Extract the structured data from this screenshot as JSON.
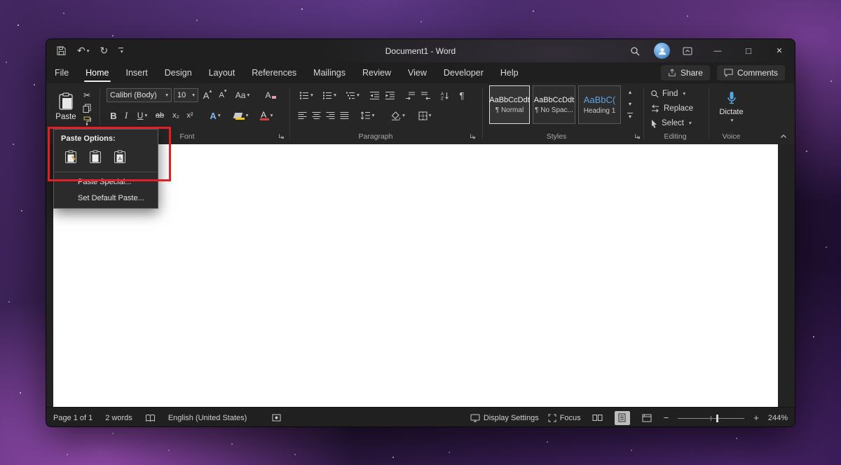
{
  "titlebar": {
    "title": "Document1  -  Word"
  },
  "tabs": {
    "items": [
      {
        "label": "File"
      },
      {
        "label": "Home"
      },
      {
        "label": "Insert"
      },
      {
        "label": "Design"
      },
      {
        "label": "Layout"
      },
      {
        "label": "References"
      },
      {
        "label": "Mailings"
      },
      {
        "label": "Review"
      },
      {
        "label": "View"
      },
      {
        "label": "Developer"
      },
      {
        "label": "Help"
      }
    ],
    "share": "Share",
    "comments": "Comments"
  },
  "ribbon": {
    "paste_label": "Paste",
    "font_name": "Calibri (Body)",
    "font_size": "10",
    "grow": "A",
    "shrink": "A",
    "change_case": "Aa",
    "clear": "A",
    "bold": "B",
    "italic": "I",
    "underline": "U",
    "strikethrough": "ab",
    "subscript": "x₂",
    "superscript": "x²",
    "effects": "A",
    "font_color": "A",
    "groups": {
      "font": "Font",
      "paragraph": "Paragraph",
      "styles": "Styles",
      "editing": "Editing",
      "voice": "Voice"
    },
    "styles": [
      {
        "preview": "AaBbCcDdt",
        "name": "¶ Normal"
      },
      {
        "preview": "AaBbCcDdt",
        "name": "¶ No Spac..."
      },
      {
        "preview": "AaBbC(",
        "name": "Heading 1"
      }
    ],
    "editing": {
      "find": "Find",
      "replace": "Replace",
      "select": "Select"
    },
    "voice": {
      "dictate": "Dictate"
    }
  },
  "paste_menu": {
    "title": "Paste Options:",
    "items": [
      {
        "label": "Paste Special..."
      },
      {
        "label": "Set Default Paste..."
      }
    ]
  },
  "status": {
    "page": "Page 1 of 1",
    "words": "2 words",
    "language": "English (United States)",
    "display_settings": "Display Settings",
    "focus": "Focus",
    "zoom_out": "−",
    "zoom_in": "+",
    "zoom": "244%"
  },
  "icons": {
    "caret": "▾",
    "caret_up": "▴",
    "pilcrow": "¶",
    "cut": "✂",
    "undo": "↶",
    "redo": "↻",
    "minimize": "—",
    "maximize": "□",
    "close": "✕"
  }
}
